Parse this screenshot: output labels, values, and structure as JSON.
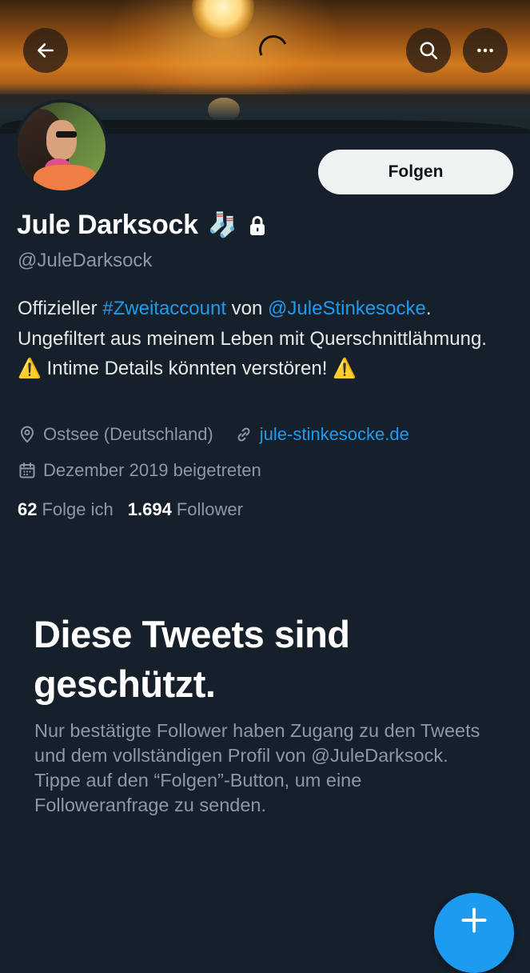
{
  "header": {
    "back_icon": "arrow-left-icon",
    "search_icon": "search-icon",
    "more_icon": "more-horizontal-icon"
  },
  "profile": {
    "display_name": "Jule Darksock",
    "name_emoji": "🧦",
    "protected_icon": "lock-icon",
    "handle": "@JuleDarksock",
    "follow_label": "Folgen",
    "bio": {
      "part1": "Offizieller ",
      "hashtag": "#Zweitaccount",
      "part2": " von ",
      "mention": "@JuleStinkesocke",
      "part3": ". Ungefiltert aus meinem Leben mit Querschnittlähmung. ",
      "warning_emoji": "⚠️",
      "part4": " Intime Details könnten verstören! "
    },
    "location": "Ostsee (Deutschland)",
    "website": "jule-stinkesocke.de",
    "joined": "Dezember 2019 beigetreten",
    "following_count": "62",
    "following_label": "Folge ich",
    "followers_count": "1.694",
    "followers_label": "Follower"
  },
  "protected_notice": {
    "title": "Diese Tweets sind geschützt.",
    "body": "Nur bestätigte Follower haben Zugang zu den Tweets und dem vollständigen Profil von @JuleDarksock. Tippe auf den “Folgen”-Button, um eine Followeranfrage zu senden."
  },
  "fab": {
    "icon": "plus-icon"
  },
  "colors": {
    "background": "#15202b",
    "accent": "#1d9bf0",
    "text_secondary": "#8b98a5",
    "follow_button": "#eff3f4"
  }
}
